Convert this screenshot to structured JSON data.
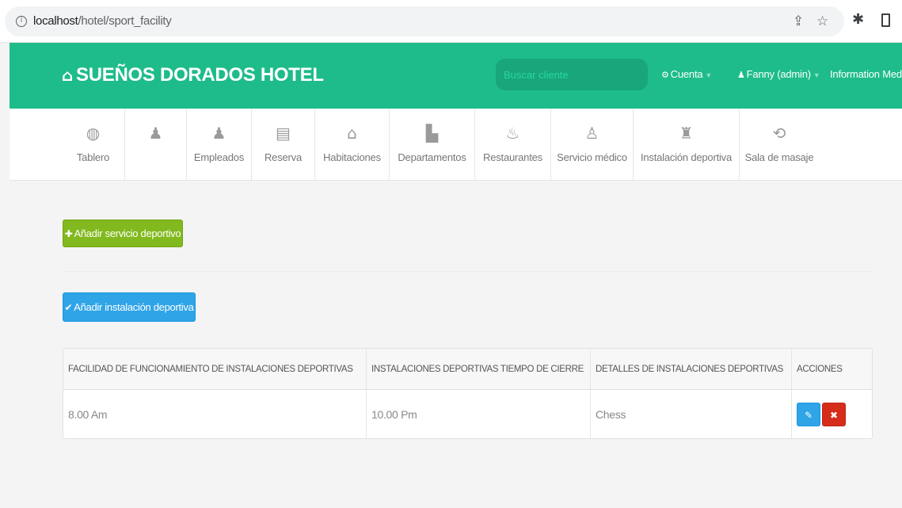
{
  "browser": {
    "url_host": "localhost",
    "url_path": "/hotel/sport_facility"
  },
  "navbar": {
    "brand": "SUEÑOS DORADOS HOTEL",
    "search_placeholder": "Buscar cliente",
    "account_label": "Cuenta",
    "user_label": "Fanny (admin)",
    "info_label": "Information Media",
    "colors": {
      "bar": "#1ebc8a",
      "search_bg": "#19a67a"
    }
  },
  "menu": {
    "items": [
      {
        "label": "Tablero",
        "icon": "dashboard-icon"
      },
      {
        "label": "",
        "icon": "user-icon"
      },
      {
        "label": "Empleados",
        "icon": "user-icon"
      },
      {
        "label": "Reserva",
        "icon": "list-icon"
      },
      {
        "label": "Habitaciones",
        "icon": "home-icon"
      },
      {
        "label": "Departamentos",
        "icon": "file-icon"
      },
      {
        "label": "Restaurantes",
        "icon": "fire-icon"
      },
      {
        "label": "Servicio médico",
        "icon": "user-md-icon"
      },
      {
        "label": "Instalación deportiva",
        "icon": "trophy-icon"
      },
      {
        "label": "Sala de masaje",
        "icon": "retweet-icon"
      }
    ]
  },
  "actions": {
    "add_service": "Añadir servicio deportivo",
    "add_facility": "Añadir instalación deportiva",
    "colors": {
      "green": "#82b91e",
      "blue": "#2fa4e7",
      "red": "#d62c1a"
    }
  },
  "table": {
    "headers": [
      "FACILIDAD DE FUNCIONAMIENTO DE INSTALACIONES DEPORTIVAS",
      "INSTALACIONES DEPORTIVAS TIEMPO DE CIERRE",
      "DETALLES DE INSTALACIONES DEPORTIVAS",
      "ACCIONES"
    ],
    "rows": [
      {
        "opening": "8.00 Am",
        "closing": "10.00 Pm",
        "details": "Chess"
      }
    ]
  }
}
